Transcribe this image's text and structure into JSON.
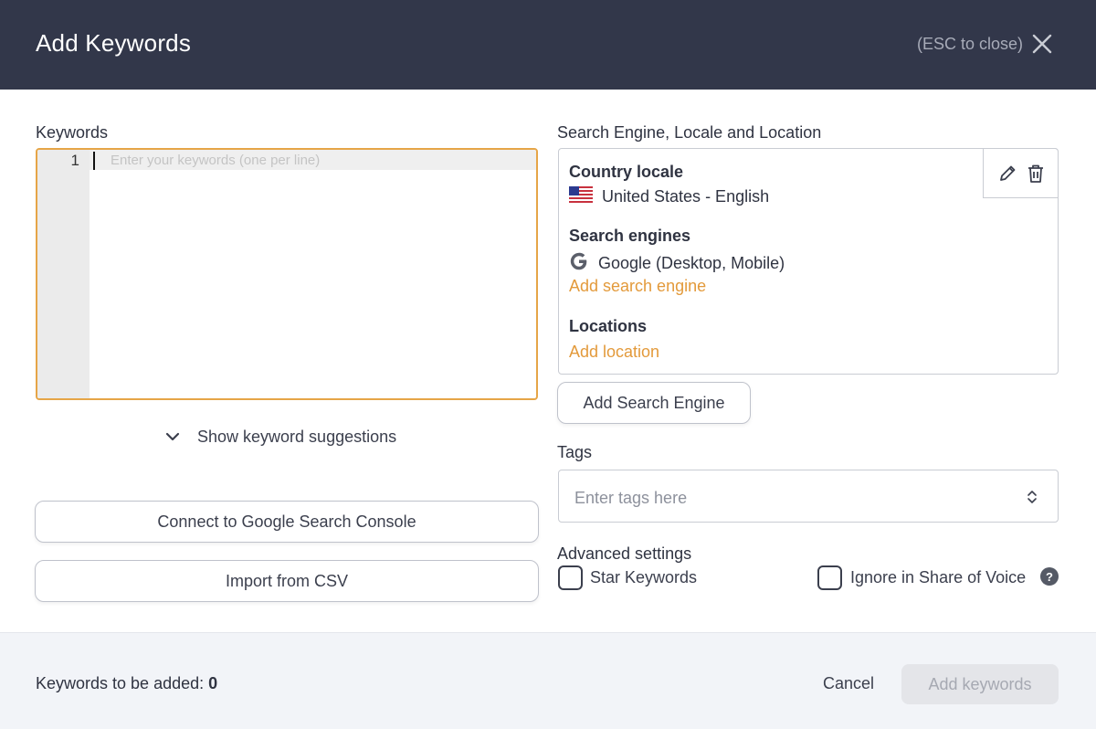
{
  "header": {
    "title": "Add Keywords",
    "esc_hint": "(ESC to close)"
  },
  "keywords": {
    "label": "Keywords",
    "line_number": "1",
    "placeholder": "Enter your keywords (one per line)",
    "suggestions_label": "Show keyword suggestions",
    "connect_gsc_label": "Connect to Google Search Console",
    "import_csv_label": "Import from CSV"
  },
  "engine_section": {
    "label": "Search Engine, Locale and Location",
    "country_locale_heading": "Country locale",
    "country_locale_value": "United States - English",
    "search_engines_heading": "Search engines",
    "search_engine_value": "Google (Desktop, Mobile)",
    "add_search_engine_link": "Add search engine",
    "locations_heading": "Locations",
    "add_location_link": "Add location",
    "add_search_engine_button": "Add Search Engine"
  },
  "tags": {
    "label": "Tags",
    "placeholder": "Enter tags here"
  },
  "advanced": {
    "label": "Advanced settings",
    "star_keywords_label": "Star Keywords",
    "star_keywords_checked": false,
    "ignore_sov_label": "Ignore in Share of Voice",
    "ignore_sov_checked": false,
    "help_glyph": "?"
  },
  "footer": {
    "count_label": "Keywords to be added:",
    "count_value": "0",
    "cancel_label": "Cancel",
    "add_label": "Add keywords"
  },
  "colors": {
    "header_bg": "#32374a",
    "accent_orange": "#e39a3b",
    "editor_focus_border": "#e6a547",
    "footer_bg": "#f2f4f8"
  },
  "icons": {
    "close": "close-icon",
    "chevron": "chevron-down-icon",
    "flag": "us-flag-icon",
    "google": "google-icon",
    "edit": "pencil-icon",
    "delete": "trash-icon",
    "select": "up-down-chevron-icon",
    "help": "help-icon"
  }
}
